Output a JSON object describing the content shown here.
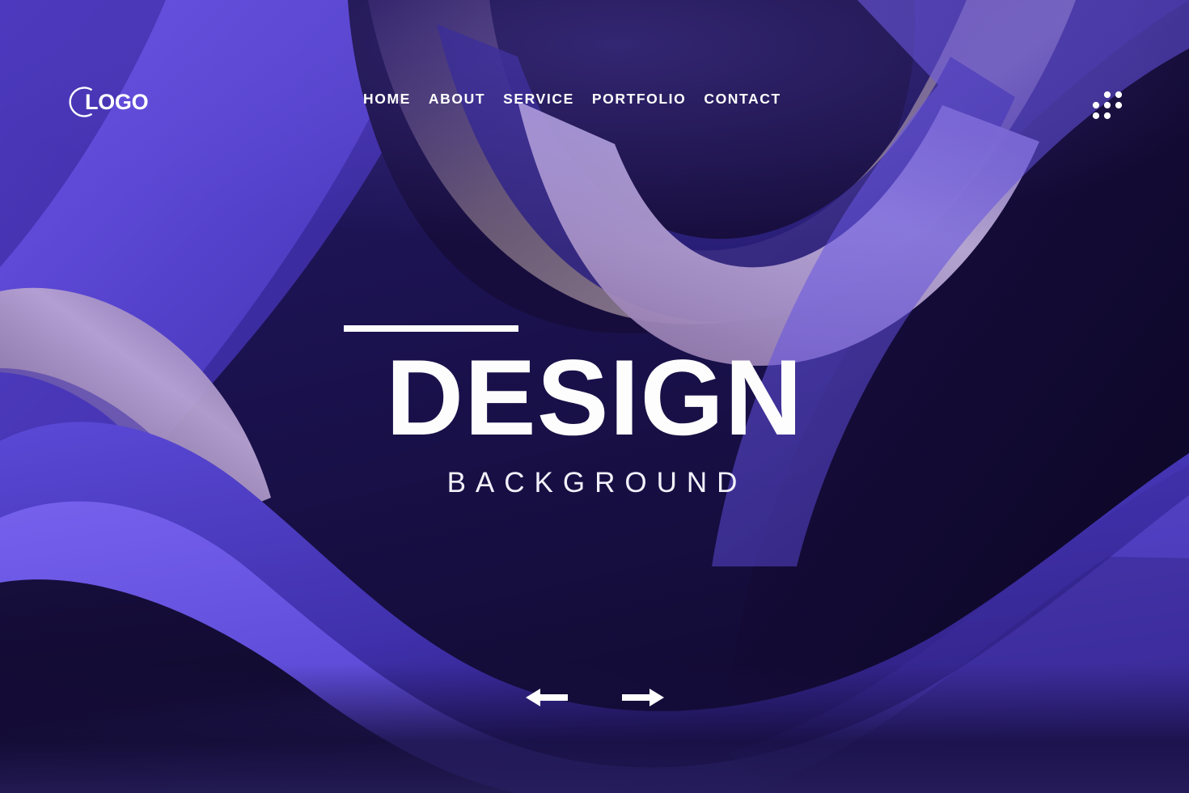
{
  "page": {
    "title": "DESIGN",
    "subtitle": "BACKGROUND"
  },
  "brand": {
    "label": "LOGO",
    "icon": "ring-arc-icon"
  },
  "nav": {
    "items": [
      {
        "label": "HOME"
      },
      {
        "label": "ABOUT"
      },
      {
        "label": "SERVICE"
      },
      {
        "label": "PORTFOLIO"
      },
      {
        "label": "CONTACT"
      }
    ]
  },
  "menu": {
    "icon": "dot-grid-icon"
  },
  "carousel": {
    "prev_icon": "arrow-left-icon",
    "next_icon": "arrow-right-icon"
  },
  "colors": {
    "text_white": "#fdfdfd",
    "deep_navy": "#140c38",
    "darkest": "#0d0722",
    "indigo": "#3a2a9c",
    "violet": "#5b45d6",
    "periwinkle": "#6f5ae8",
    "lavender": "#9e8bc8",
    "lavender_light": "#b9a8d6",
    "mauve": "#6e5a78"
  }
}
